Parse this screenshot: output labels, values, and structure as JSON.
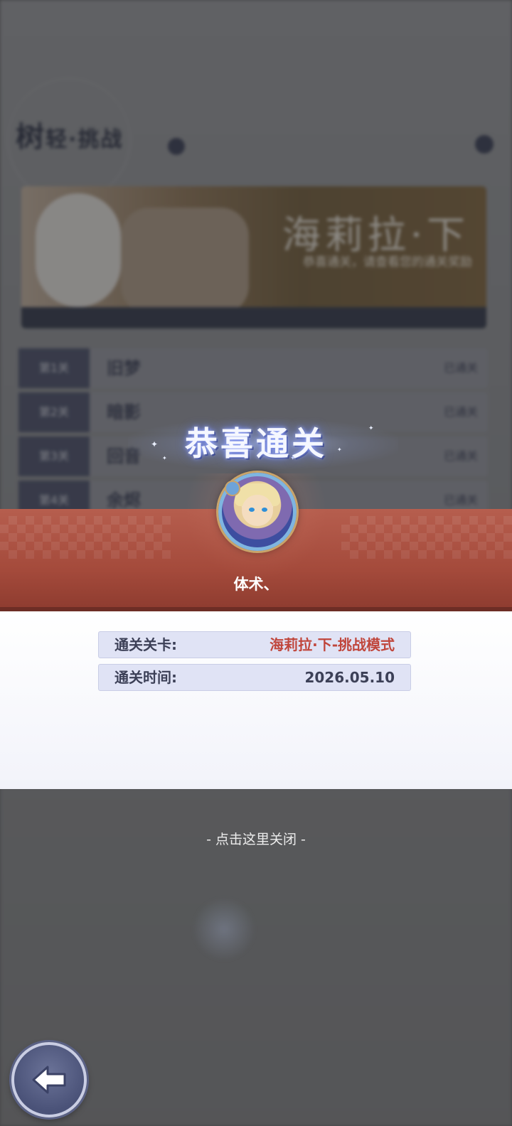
{
  "background": {
    "title_main": "树",
    "title_sub": "轻·挑战",
    "banner": {
      "title": "海莉拉·下",
      "subtitle": "恭喜通关，请查看您的通关奖励"
    },
    "rows": [
      {
        "num": "第1关",
        "name": "旧梦",
        "status": "已通关"
      },
      {
        "num": "第2关",
        "name": "暗影",
        "status": "已通关"
      },
      {
        "num": "第3关",
        "name": "回音",
        "status": "已通关"
      },
      {
        "num": "第4关",
        "name": "余烬",
        "status": "已通关"
      }
    ]
  },
  "result": {
    "congrats_title": "恭喜通关",
    "player_name": "体术、",
    "info": [
      {
        "label": "通关关卡:",
        "value": "海莉拉·下-挑战模式",
        "value_color": "#c0463c"
      },
      {
        "label": "通关时间:",
        "value": "2026.05.10",
        "value_color": "#3c4057"
      }
    ],
    "close_hint": "- 点击这里关闭 -"
  },
  "icons": {
    "back": "arrow-left-icon",
    "avatar": "character-avatar"
  },
  "colors": {
    "red_band": "#a44a3b",
    "stage_value": "#c0463c",
    "panel_bg": "#ffffff"
  }
}
